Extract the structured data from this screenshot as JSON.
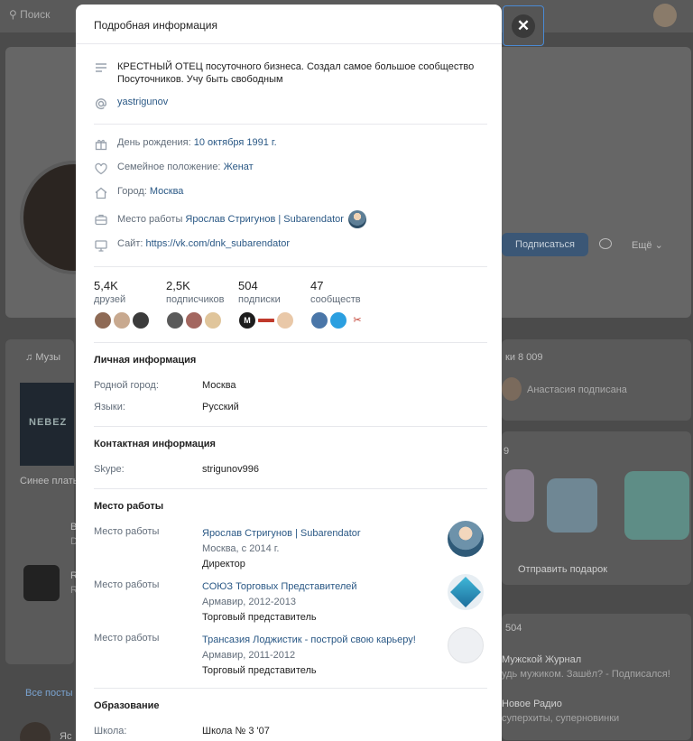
{
  "background": {
    "search_placeholder": "Поиск",
    "subscribe_button": "Подписаться",
    "more_button": "Ещё",
    "music_label": "Музы",
    "nebez": "NEBEZ",
    "song_title": "Синее плать",
    "friends_count": "ки 8 009",
    "subscribed_text": "Анастасия подписана",
    "gifts_count": "9",
    "send_gift": "Отправить подарок",
    "groups_count": "504",
    "group1_name": "Мужской Журнал",
    "group1_sub": "удь мужиком. Зашёл? - Подписался!",
    "group2_name": "Новое Радио",
    "group2_sub": "суперхиты, суперновинки",
    "all_posts": "Все посты",
    "item_b": "В",
    "item_d": "D",
    "item_r": "R",
    "item_r2": "R",
    "item_ya": "Яс"
  },
  "modal": {
    "title": "Подробная информация",
    "close_icon": "close-icon",
    "bio": "КРЕСТНЫЙ ОТЕЦ посуточного бизнеса. Создал самое большое сообщество Посуточников. Учу быть свободным",
    "username": "yastrigunov",
    "birthday_label": "День рождения:",
    "birthday_value": "10 октября 1991 г.",
    "family_label": "Семейное положение:",
    "family_value": "Женат",
    "city_label": "Город:",
    "city_value": "Москва",
    "work_label": "Место работы",
    "work_value": "Ярослав Стригунов | Subarendator",
    "site_label": "Сайт:",
    "site_value": "https://vk.com/dnk_subarendator",
    "counters": [
      {
        "num": "5,4K",
        "label": "друзей"
      },
      {
        "num": "2,5K",
        "label": "подписчиков"
      },
      {
        "num": "504",
        "label": "подписки"
      },
      {
        "num": "47",
        "label": "сообществ"
      }
    ],
    "personal": {
      "title": "Личная информация",
      "hometown_label": "Родной город:",
      "hometown_value": "Москва",
      "languages_label": "Языки:",
      "languages_value": "Русский"
    },
    "contact": {
      "title": "Контактная информация",
      "skype_label": "Skype:",
      "skype_value": "strigunov996"
    },
    "career": {
      "title": "Место работы",
      "jobs": [
        {
          "label": "Место работы",
          "company": "Ярослав Стригунов | Subarendator",
          "meta": "Москва, с 2014 г.",
          "position": "Директор"
        },
        {
          "label": "Место работы",
          "company": "СОЮЗ Торговых Представителей",
          "meta": "Армавир, 2012-2013",
          "position": "Торговый представитель"
        },
        {
          "label": "Место работы",
          "company": "Трансазия Лоджистик - построй свою карьеру!",
          "meta": "Армавир, 2011-2012",
          "position": "Торговый представитель"
        }
      ]
    },
    "education": {
      "title": "Образование",
      "school_label": "Школа:",
      "school_value": "Школа № 3 '07"
    }
  }
}
